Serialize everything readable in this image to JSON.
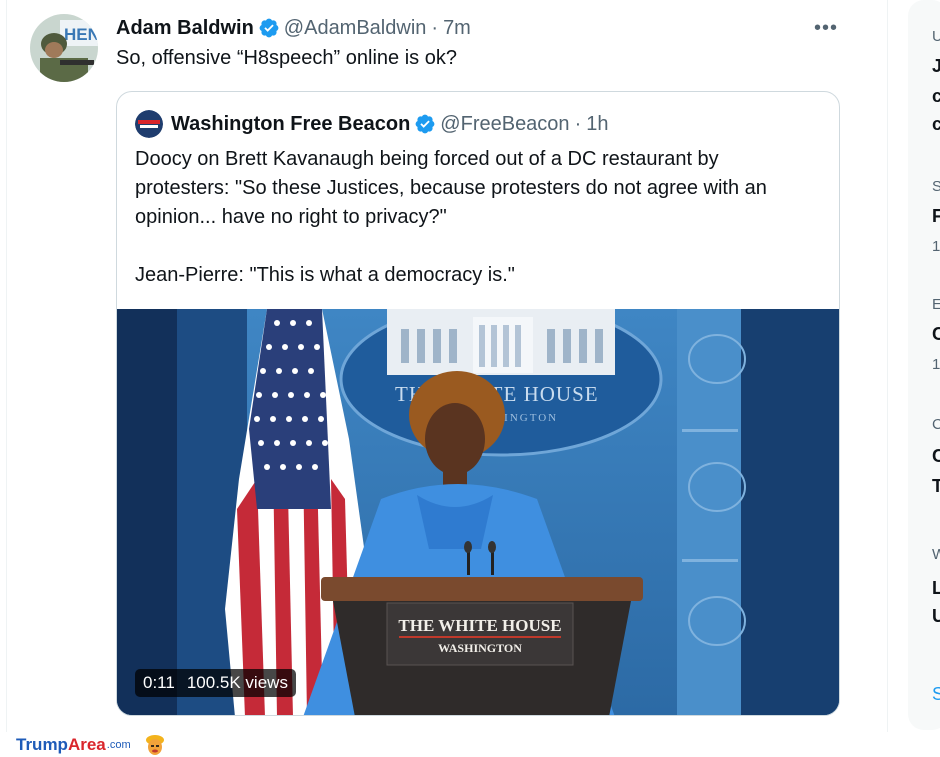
{
  "tweet": {
    "author_name": "Adam Baldwin",
    "handle": "@AdamBaldwin",
    "dot": "·",
    "time": "7m",
    "text": "So, offensive “H8speech” online is ok?",
    "more_label": "•••",
    "avatar_sign_text": "HEN"
  },
  "quote": {
    "author_name": "Washington Free Beacon",
    "handle": "@FreeBeacon",
    "dot": "·",
    "time": "1h",
    "lines": [
      "Doocy on Brett Kavanaugh being forced out of a DC restaurant by",
      "protesters: \"So these Justices, because protesters do not agree with an",
      "opinion... have no right to privacy?\""
    ],
    "line2": "Jean-Pierre: \"This is what a democracy is.\"",
    "video": {
      "duration": "0:11",
      "views": "100.5K views",
      "backdrop_text": "THE WHITE HOUSE",
      "backdrop_subtext": "WASHINGTON",
      "podium_title": "THE WHITE HOUSE",
      "podium_subtitle": "WASHINGTON"
    }
  },
  "sidebar": {
    "items": [
      {
        "muted": "U",
        "bold": [
          "J",
          "c",
          "c"
        ]
      },
      {
        "muted": "S",
        "bold": [
          "F"
        ],
        "count": "1"
      },
      {
        "muted": "E",
        "bold": [
          "C"
        ],
        "count": "1"
      },
      {
        "muted": "C",
        "bold": [
          "C",
          "T"
        ]
      },
      {
        "muted": "W",
        "bold": [
          "L",
          "U"
        ]
      },
      {
        "link": "S"
      }
    ]
  },
  "watermark": {
    "trump": "Trump",
    "area": "Area",
    "com": ".com"
  },
  "colors": {
    "verified": "#1d9bf0",
    "text": "#0f1419",
    "muted": "#536471",
    "border": "#cfd9de"
  }
}
